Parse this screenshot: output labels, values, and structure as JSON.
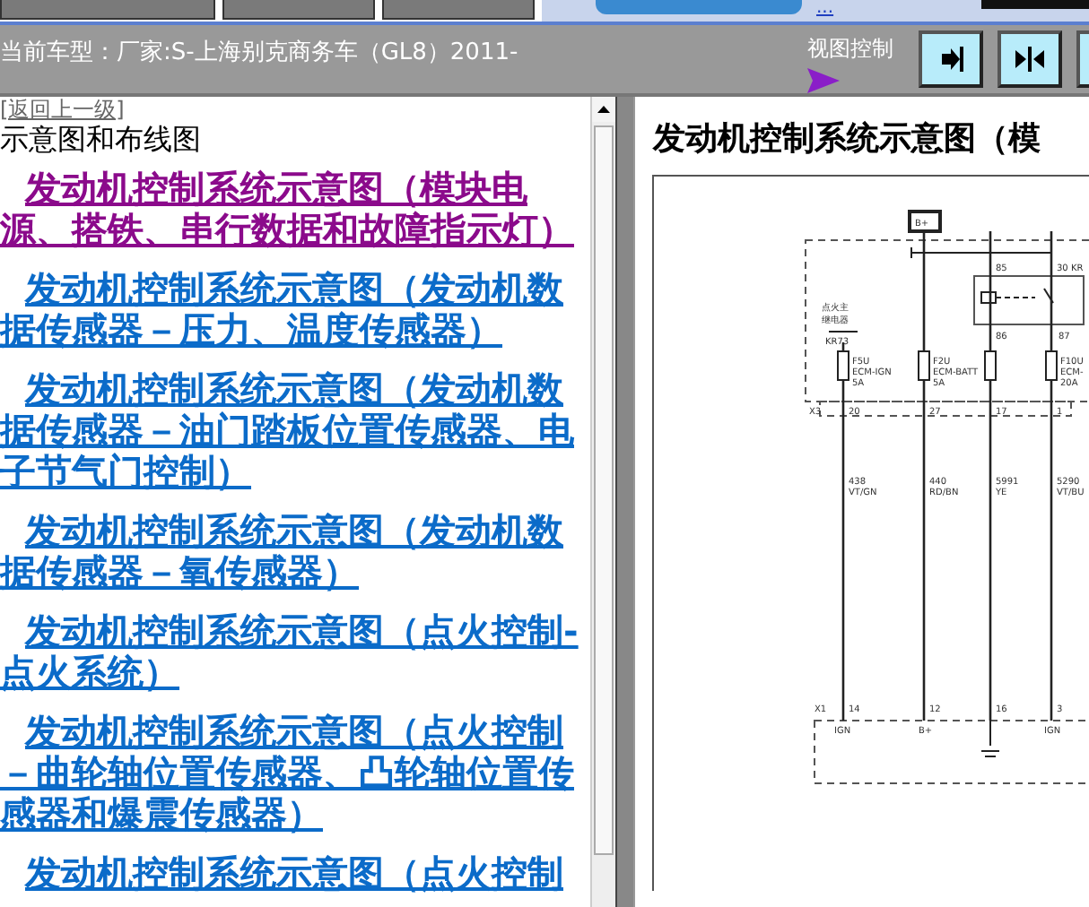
{
  "top_strip": {
    "link": "..."
  },
  "header": {
    "vehicle": "当前车型：厂家:S-上海别克商务车（GL8）2011-",
    "view_control": "视图控制"
  },
  "sidebar": {
    "back_link": "[返回上一级]",
    "heading": "示意图和布线图",
    "items": [
      {
        "label": "发动机控制系统示意图（模块电源、搭铁、串行数据和故障指示灯）",
        "visited": true
      },
      {
        "label": "发动机控制系统示意图（发动机数据传感器－压力、温度传感器）",
        "visited": false
      },
      {
        "label": "发动机控制系统示意图（发动机数据传感器－油门踏板位置传感器、电子节气门控制）",
        "visited": false
      },
      {
        "label": "发动机控制系统示意图（发动机数据传感器－氧传感器）",
        "visited": false
      },
      {
        "label": "发动机控制系统示意图（点火控制-点火系统）",
        "visited": false
      },
      {
        "label": "发动机控制系统示意图（点火控制－曲轮轴位置传感器、凸轮轴位置传感器和爆震传感器）",
        "visited": false
      },
      {
        "label": "发动机控制系统示意图（点火控制",
        "visited": false
      }
    ]
  },
  "content": {
    "title": "发动机控制系统示意图（模",
    "diagram_labels": [
      "B+",
      "85",
      "30 KR",
      "点火主",
      "继电器",
      "KR73",
      "F5U",
      "ECM-IGN",
      "5A",
      "F2U",
      "ECM-BATT",
      "5A",
      "86",
      "87",
      "F10U",
      "ECM-",
      "20A",
      "X3",
      "20",
      "27",
      "17",
      "1",
      "438",
      "VT/GN",
      "440",
      "RD/BN",
      "5991",
      "YE",
      "5290",
      "VT/BU",
      "X1",
      "14",
      "12",
      "16",
      "3",
      "IGN",
      "B+",
      "IGN"
    ]
  }
}
